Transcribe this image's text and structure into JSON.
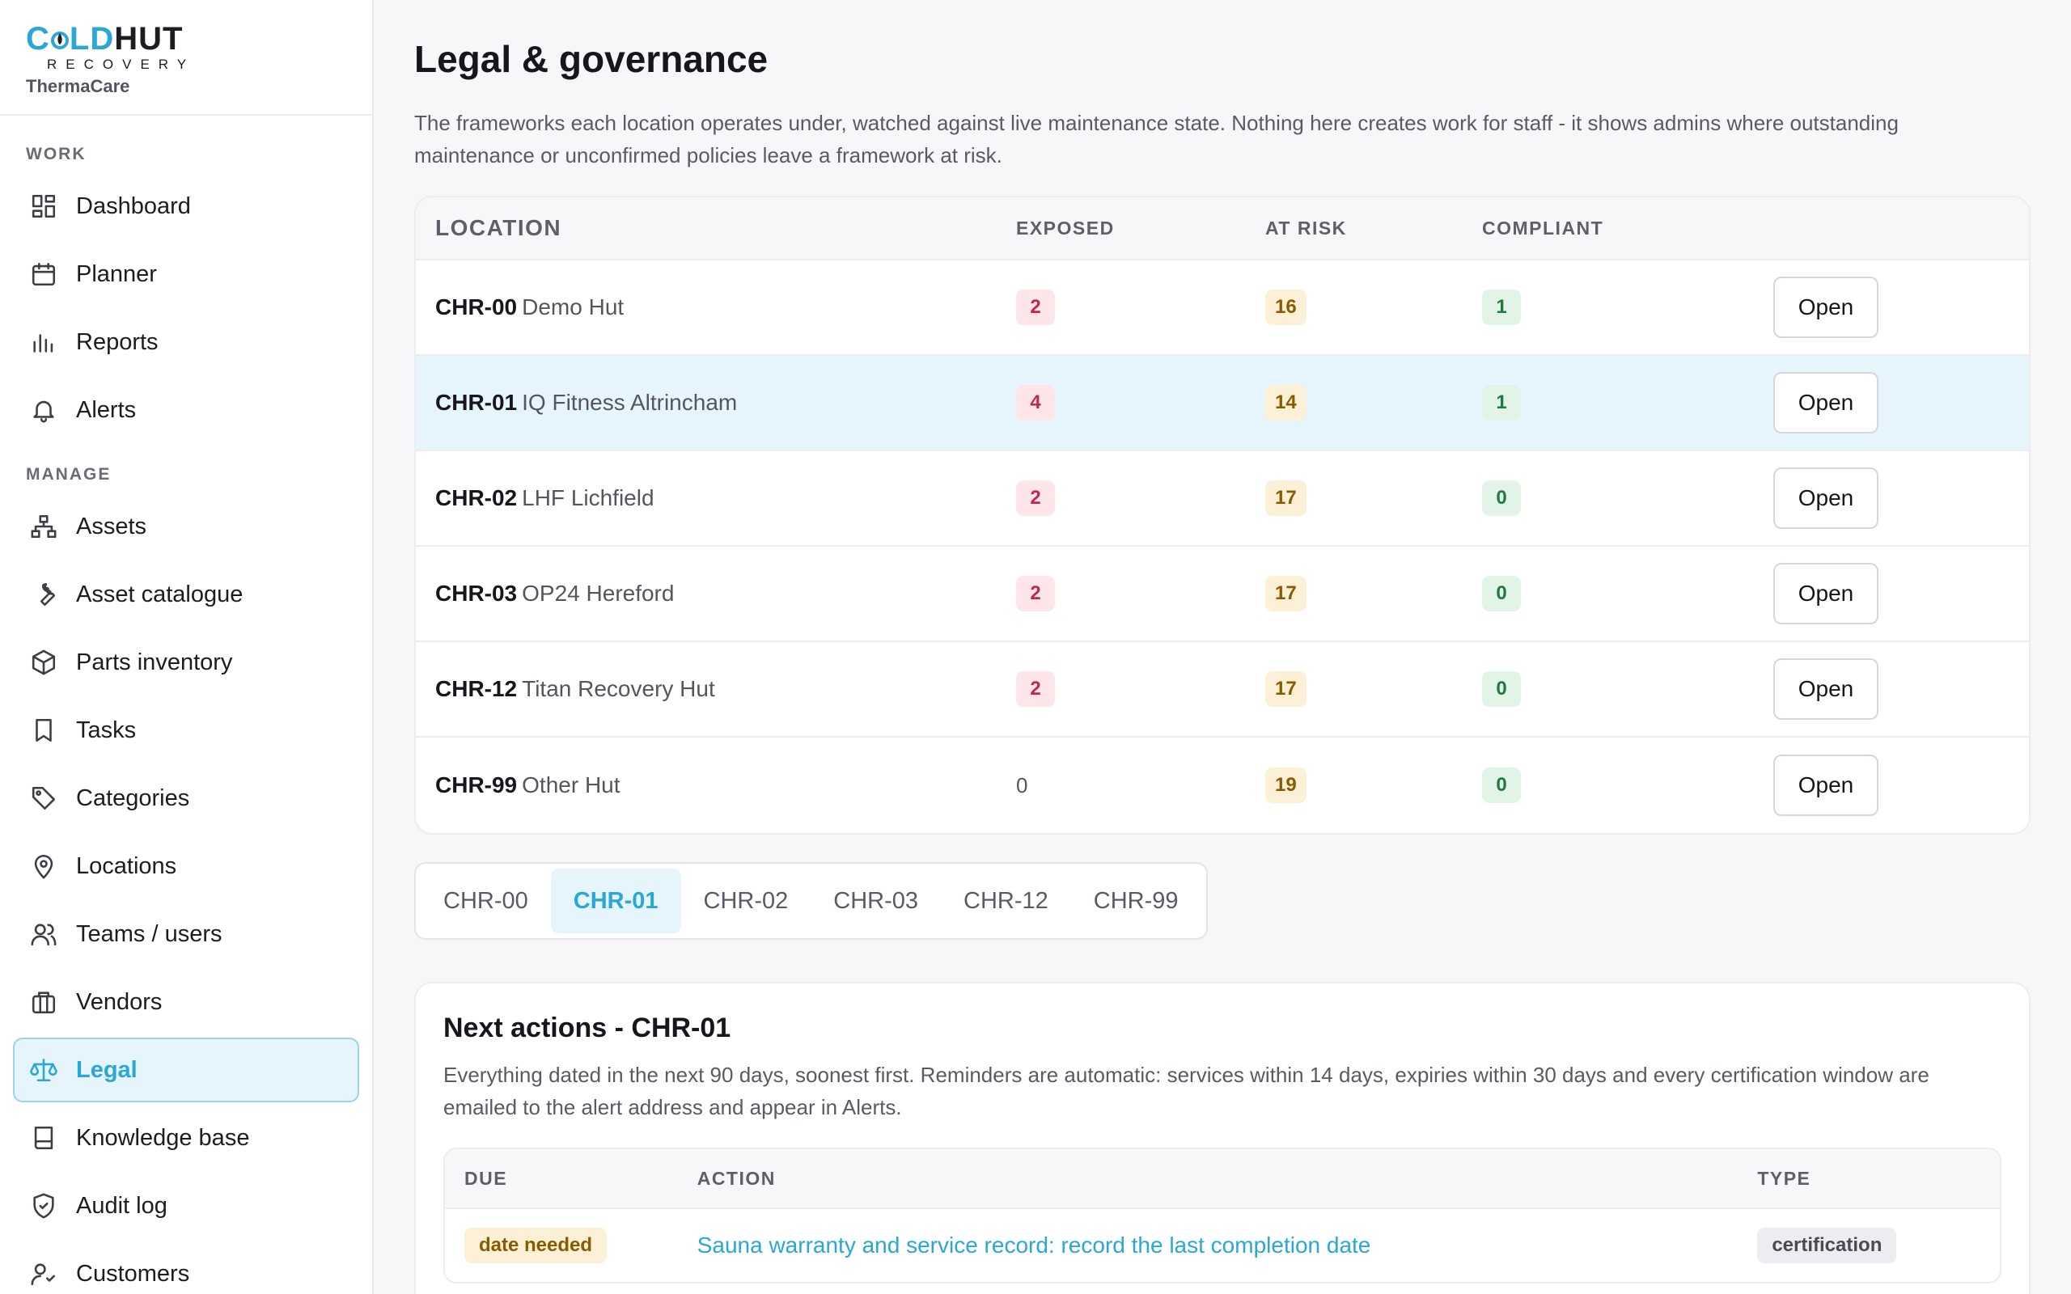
{
  "brand": {
    "logo_cold": "C",
    "logo_o_mid": "LD",
    "logo_hut": "HUT",
    "logo_sub": "RECOVERY",
    "org": "ThermaCare"
  },
  "nav": {
    "work_label": "WORK",
    "manage_label": "MANAGE",
    "work_items": [
      {
        "label": "Dashboard",
        "icon": "dashboard-icon"
      },
      {
        "label": "Planner",
        "icon": "calendar-icon"
      },
      {
        "label": "Reports",
        "icon": "bar-chart-icon"
      },
      {
        "label": "Alerts",
        "icon": "bell-icon"
      }
    ],
    "manage_items": [
      {
        "label": "Assets",
        "icon": "hierarchy-icon"
      },
      {
        "label": "Asset catalogue",
        "icon": "wrench-icon"
      },
      {
        "label": "Parts inventory",
        "icon": "box-icon"
      },
      {
        "label": "Tasks",
        "icon": "bookmark-icon"
      },
      {
        "label": "Categories",
        "icon": "tag-icon"
      },
      {
        "label": "Locations",
        "icon": "map-pin-icon"
      },
      {
        "label": "Teams / users",
        "icon": "users-icon"
      },
      {
        "label": "Vendors",
        "icon": "briefcase-icon"
      },
      {
        "label": "Legal",
        "icon": "scales-icon"
      },
      {
        "label": "Knowledge base",
        "icon": "book-icon"
      },
      {
        "label": "Audit log",
        "icon": "shield-icon"
      },
      {
        "label": "Customers",
        "icon": "customer-icon"
      }
    ]
  },
  "page": {
    "title": "Legal & governance",
    "intro": "The frameworks each location operates under, watched against live maintenance state. Nothing here creates work for staff - it shows admins where outstanding maintenance or unconfirmed policies leave a framework at risk."
  },
  "locations_table": {
    "headers": {
      "location": "LOCATION",
      "exposed": "EXPOSED",
      "at_risk": "AT RISK",
      "compliant": "COMPLIANT"
    },
    "open_label": "Open",
    "rows": [
      {
        "code": "CHR-00",
        "name": "Demo Hut",
        "exposed": "2",
        "at_risk": "16",
        "compliant": "1"
      },
      {
        "code": "CHR-01",
        "name": "IQ Fitness Altrincham",
        "exposed": "4",
        "at_risk": "14",
        "compliant": "1"
      },
      {
        "code": "CHR-02",
        "name": "LHF Lichfield",
        "exposed": "2",
        "at_risk": "17",
        "compliant": "0"
      },
      {
        "code": "CHR-03",
        "name": "OP24 Hereford",
        "exposed": "2",
        "at_risk": "17",
        "compliant": "0"
      },
      {
        "code": "CHR-12",
        "name": "Titan Recovery Hut",
        "exposed": "2",
        "at_risk": "17",
        "compliant": "0"
      },
      {
        "code": "CHR-99",
        "name": "Other Hut",
        "exposed": "0",
        "at_risk": "19",
        "compliant": "0"
      }
    ]
  },
  "tabs": [
    "CHR-00",
    "CHR-01",
    "CHR-02",
    "CHR-03",
    "CHR-12",
    "CHR-99"
  ],
  "actions": {
    "title": "Next actions - CHR-01",
    "description": "Everything dated in the next 90 days, soonest first. Reminders are automatic: services within 14 days, expiries within 30 days and every certification window are emailed to the alert address and appear in Alerts.",
    "headers": {
      "due": "DUE",
      "action": "ACTION",
      "type": "TYPE"
    },
    "rows": [
      {
        "due": "date needed",
        "action": "Sauna warranty and service record: record the last completion date",
        "type": "certification"
      }
    ]
  }
}
